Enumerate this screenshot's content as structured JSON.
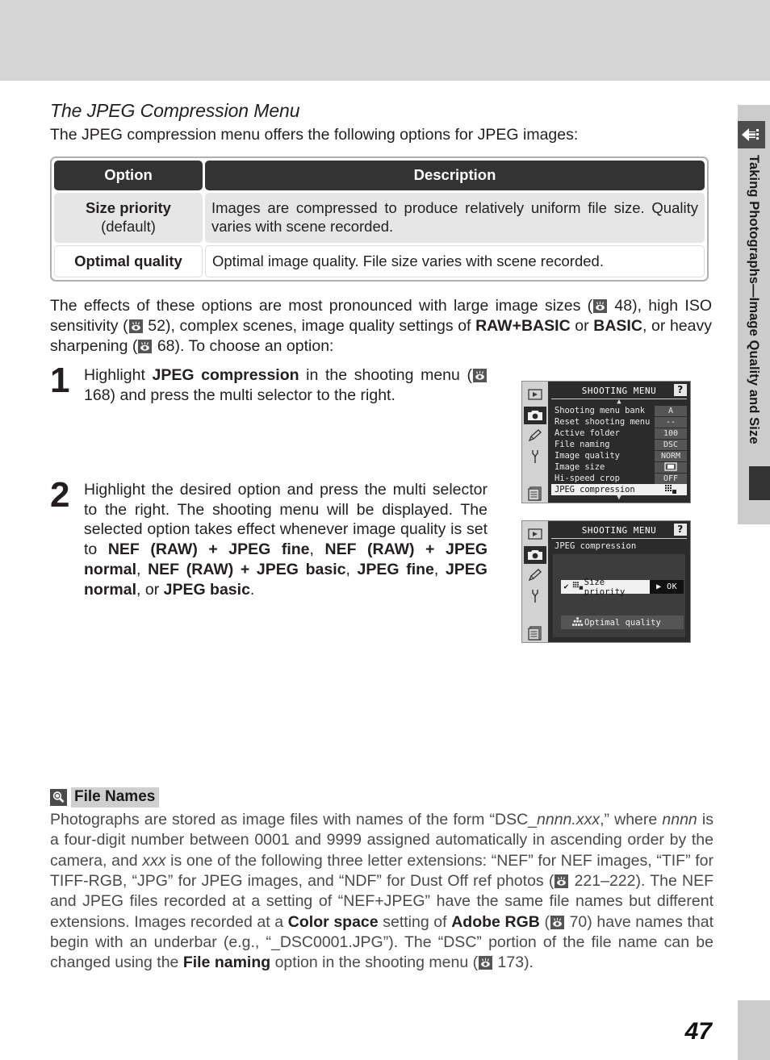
{
  "page": {
    "number": "47",
    "side_tab_label": "Taking Photographs—Image Quality and Size",
    "side_tab_icon": "image-size-arrow-icon"
  },
  "section": {
    "title": "The JPEG Compression Menu",
    "intro": "The JPEG compression menu offers the following options for JPEG images:"
  },
  "table": {
    "headers": [
      "Option",
      "Description"
    ],
    "rows": [
      {
        "option_main": "Size priority",
        "option_sub": "(default)",
        "description": "Images are compressed to produce relatively uniform file size. Quality varies with scene recorded."
      },
      {
        "option_main": "Optimal quality",
        "option_sub": "",
        "description": "Optimal image quality.  File size varies with scene recorded."
      }
    ]
  },
  "effects_paragraph": {
    "part1": "The effects of these options are most pronounced with large image sizes (",
    "ref1": "48",
    "part2": "), high ISO sensitivity (",
    "ref2": "52",
    "part3": "), complex scenes, image quality settings of ",
    "bold1": "RAW+BASIC",
    "part4": " or ",
    "bold2": "BASIC",
    "part5": ", or heavy sharpening (",
    "ref3": "68",
    "part6": ").  To choose an option:"
  },
  "steps": [
    {
      "number": "1",
      "part1": "Highlight ",
      "bold1": "JPEG compression",
      "part2": " in the shooting menu (",
      "ref": "168",
      "part3": ") and press the multi selector to the right."
    },
    {
      "number": "2",
      "part1": "Highlight the desired option and press the multi selector to the right.  The shooting menu will be displayed.  The selected option takes effect whenever image quality is set to ",
      "bold1": "NEF (RAW) + JPEG fine",
      "sep1": ", ",
      "bold2": "NEF (RAW) + JPEG normal",
      "sep2": ", ",
      "bold3": "NEF (RAW) + JPEG basic",
      "sep3": ", ",
      "bold4": "JPEG fine",
      "sep4": ", ",
      "bold5": "JPEG normal",
      "sep5": ", or ",
      "bold6": "JPEG basic",
      "part_end": "."
    }
  ],
  "lcd1": {
    "title": "SHOOTING MENU",
    "help_label": "?",
    "sidebar_icons": [
      "playback-icon",
      "camera-icon",
      "pencil-icon",
      "wrench-icon",
      "recent-settings-icon"
    ],
    "selected_sidebar_index": 1,
    "rows": [
      {
        "label": "Shooting menu bank",
        "value": "A",
        "highlighted": false
      },
      {
        "label": "Reset shooting menu",
        "value": "--",
        "highlighted": false
      },
      {
        "label": "Active folder",
        "value": "100",
        "highlighted": false
      },
      {
        "label": "File naming",
        "value": "DSC",
        "highlighted": false
      },
      {
        "label": "Image quality",
        "value": "NORM",
        "highlighted": false
      },
      {
        "label": "Image size",
        "value": "",
        "highlighted": false,
        "value_icon": "image-size-icon"
      },
      {
        "label": "Hi-speed crop",
        "value": "OFF",
        "highlighted": false
      },
      {
        "label": "JPEG compression",
        "value": "",
        "highlighted": true,
        "value_icon": "size-priority-icon"
      }
    ]
  },
  "lcd2": {
    "title": "SHOOTING MENU",
    "help_label": "?",
    "subtitle": "JPEG compression",
    "sidebar_icons": [
      "playback-icon",
      "camera-icon",
      "pencil-icon",
      "wrench-icon",
      "recent-settings-icon"
    ],
    "selected_sidebar_index": 1,
    "choices": [
      {
        "label": "Size priority",
        "checked": true,
        "selected": true,
        "icon": "size-priority-icon",
        "ok_label": "OK"
      },
      {
        "label": "Optimal quality",
        "checked": false,
        "selected": false,
        "icon": "optimal-quality-icon"
      }
    ]
  },
  "note": {
    "badge_icon": "magnifier-icon",
    "title": "File Names",
    "p1": "Photographs are stored as image files with names of the form “DSC_",
    "i1": "nnnn.xxx",
    "p2": ",” where ",
    "i2": "nnnn",
    "p3": " is a four-digit number between 0001 and 9999 assigned automatically in ascending order by the camera, and ",
    "i3": "xxx",
    "p4": " is one of the following three letter extensions: “NEF” for NEF images, “TIF” for TIFF-RGB, “JPG” for JPEG images, and “NDF” for Dust Off ref photos (",
    "ref1": "221–222",
    "p5": ").  The NEF and JPEG files recorded at a setting of “NEF+JPEG” have the same file names but different extensions.  Images recorded at a ",
    "b1": "Color space",
    "p6": " setting of ",
    "b2": "Adobe RGB",
    "p7": " (",
    "ref2": "70",
    "p8": ") have names that begin with an underbar (e.g., “_DSC0001.JPG”).  The “DSC” portion of the file name can be changed using the ",
    "b3": "File naming",
    "p9": " option in the shooting menu (",
    "ref3": "173",
    "p10": ")."
  },
  "colors": {
    "page_band": "#d6d6d6",
    "table_header_bg": "#333333",
    "table_row_alt_bg": "#e6e6e6",
    "lcd_bg": "#2b2b2b",
    "lcd_highlight": "#f0f0f0",
    "side_tab_bg": "#cccccc"
  }
}
